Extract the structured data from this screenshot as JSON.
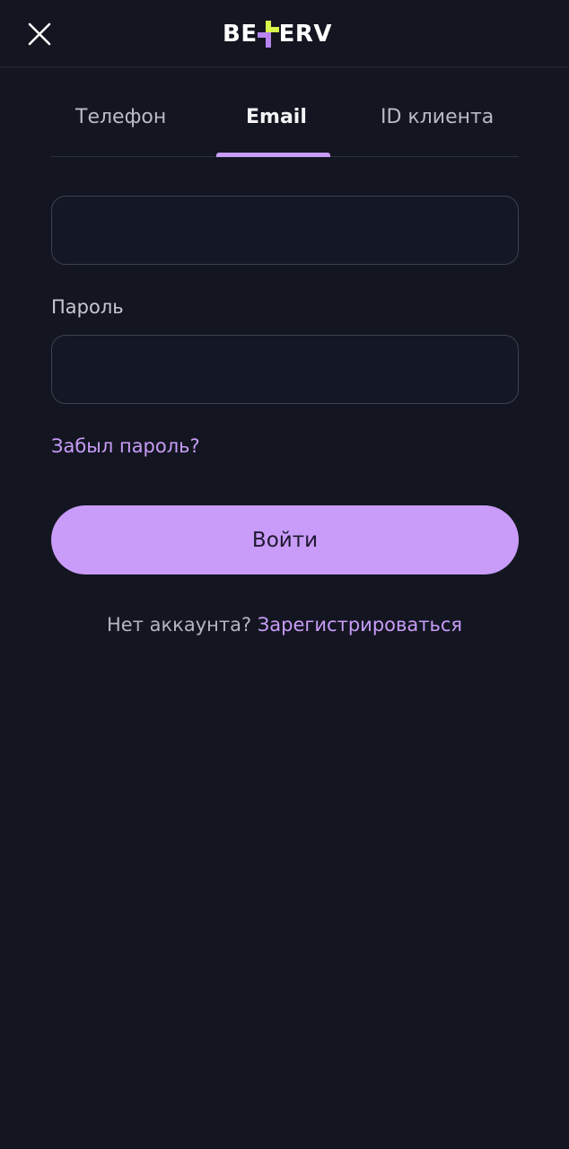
{
  "header": {
    "logo_left": "BE",
    "logo_right": "ERV",
    "logo_colors": {
      "cross_top": "#d7f84a",
      "cross_bottom": "#b784f0"
    },
    "close_icon": "close-icon"
  },
  "tabs": [
    {
      "label": "Телефон",
      "active": false
    },
    {
      "label": "Email",
      "active": true
    },
    {
      "label": "ID клиента",
      "active": false
    }
  ],
  "form": {
    "email_value": "",
    "password_label": "Пароль",
    "password_value": "",
    "forgot_label": "Забыл пароль?",
    "submit_label": "Войти"
  },
  "footer": {
    "no_account": "Нет аккаунта?",
    "register_label": "Зарегистрироваться"
  },
  "colors": {
    "background": "#131621",
    "accent": "#c89cf8",
    "border": "#3c4152"
  }
}
